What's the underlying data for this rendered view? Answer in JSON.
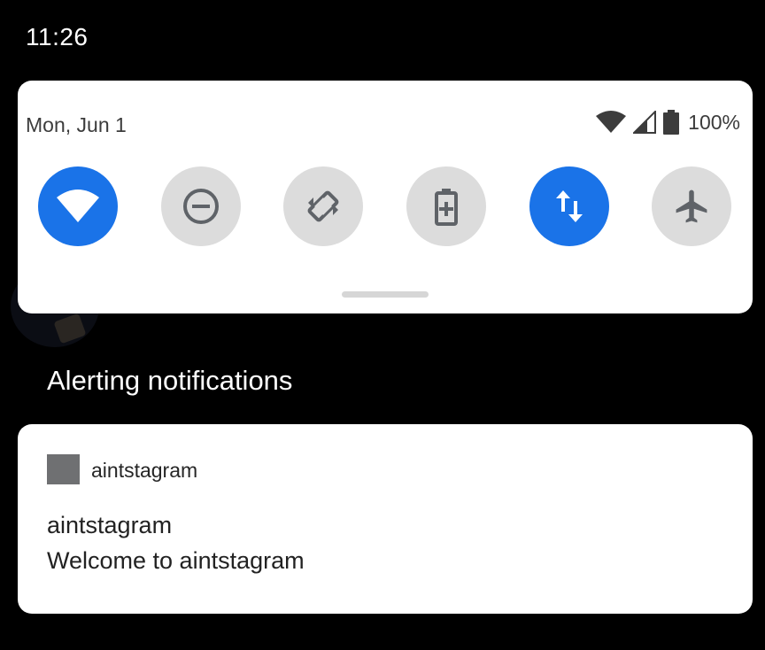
{
  "status_bar": {
    "time": "11:26"
  },
  "quick_settings": {
    "date": "Mon, Jun 1",
    "battery_percent": "100%",
    "tiles": [
      {
        "name": "wifi",
        "icon": "wifi-icon",
        "active": true
      },
      {
        "name": "do-not-disturb",
        "icon": "do-not-disturb-icon",
        "active": false
      },
      {
        "name": "auto-rotate",
        "icon": "auto-rotate-icon",
        "active": false
      },
      {
        "name": "battery-saver",
        "icon": "battery-saver-icon",
        "active": false
      },
      {
        "name": "mobile-data",
        "icon": "mobile-data-icon",
        "active": true
      },
      {
        "name": "airplane-mode",
        "icon": "airplane-icon",
        "active": false
      }
    ]
  },
  "section": {
    "title": "Alerting notifications"
  },
  "notification": {
    "app_name": "aintstagram",
    "title": "aintstagram",
    "text": "Welcome to aintstagram"
  },
  "colors": {
    "accent": "#1a73e8",
    "tile_off": "#dcdcdc",
    "background": "#000000",
    "card": "#ffffff"
  }
}
